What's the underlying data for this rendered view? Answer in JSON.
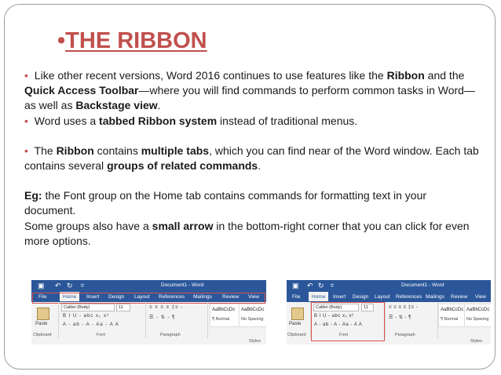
{
  "slide": {
    "title_bullet": "•",
    "title": "THE RIBBON",
    "paragraphs": [
      {
        "bullet": "•",
        "runs": [
          {
            "text": " Like other recent versions, Word 2016 continues to use features like the ",
            "bold": false
          },
          {
            "text": "Ribbon",
            "bold": true
          },
          {
            "text": " and the ",
            "bold": false
          },
          {
            "text": "Quick Access Toolbar",
            "bold": true
          },
          {
            "text": "—where you will find commands to perform common tasks in Word—as well as ",
            "bold": false
          },
          {
            "text": "Backstage view",
            "bold": true
          },
          {
            "text": ".",
            "bold": false
          }
        ]
      },
      {
        "bullet": "•",
        "runs": [
          {
            "text": " Word uses a ",
            "bold": false
          },
          {
            "text": "tabbed Ribbon system",
            "bold": true
          },
          {
            "text": " instead of traditional menus.",
            "bold": false
          }
        ]
      },
      {
        "gap": true
      },
      {
        "bullet": "•",
        "runs": [
          {
            "text": " The ",
            "bold": false
          },
          {
            "text": "Ribbon",
            "bold": true
          },
          {
            "text": " contains ",
            "bold": false
          },
          {
            "text": "multiple tabs",
            "bold": true
          },
          {
            "text": ", which you can find near of the  Word window. Each tab contains several ",
            "bold": false
          },
          {
            "text": "groups of related commands",
            "bold": true
          },
          {
            "text": ".",
            "bold": false
          }
        ]
      },
      {
        "gap": true
      },
      {
        "bullet": "",
        "runs": [
          {
            "text": "Eg:",
            "bold": true
          },
          {
            "text": "  the Font group on the Home tab contains commands for formatting text in your document.",
            "bold": false
          }
        ]
      },
      {
        "bullet": "",
        "runs": [
          {
            "text": "Some groups also have a ",
            "bold": false
          },
          {
            "text": "small arrow",
            "bold": true
          },
          {
            "text": " in the bottom-right corner that you can click for even more options.",
            "bold": false
          }
        ]
      }
    ]
  },
  "ribbon": {
    "doc_title": "Document1 - Word",
    "tabs": [
      "File",
      "Home",
      "Insert",
      "Design",
      "Layout",
      "References",
      "Mailings",
      "Review",
      "View"
    ],
    "font_name": "Calibri (Body)",
    "font_size": "11",
    "paste": "Paste",
    "groups": {
      "clipboard": "Clipboard",
      "font": "Font",
      "paragraph": "Paragraph",
      "styles": "Styles"
    },
    "styles": [
      {
        "sample": "AaBbCcDc",
        "name": "¶ Normal"
      },
      {
        "sample": "AaBbCcDc",
        "name": "No Spacing"
      }
    ],
    "font_row1": "B I U - abc x₂ x²",
    "font_row2": "A - ab - A - Aa - A A",
    "para_row1": "≡ ≡ ≡ ≡ ‡≡ -",
    "para_row2": "☰ - ⇅ - ¶",
    "qat_icons": [
      "save-icon",
      "undo-icon",
      "redo-icon",
      "customize-icon"
    ]
  }
}
